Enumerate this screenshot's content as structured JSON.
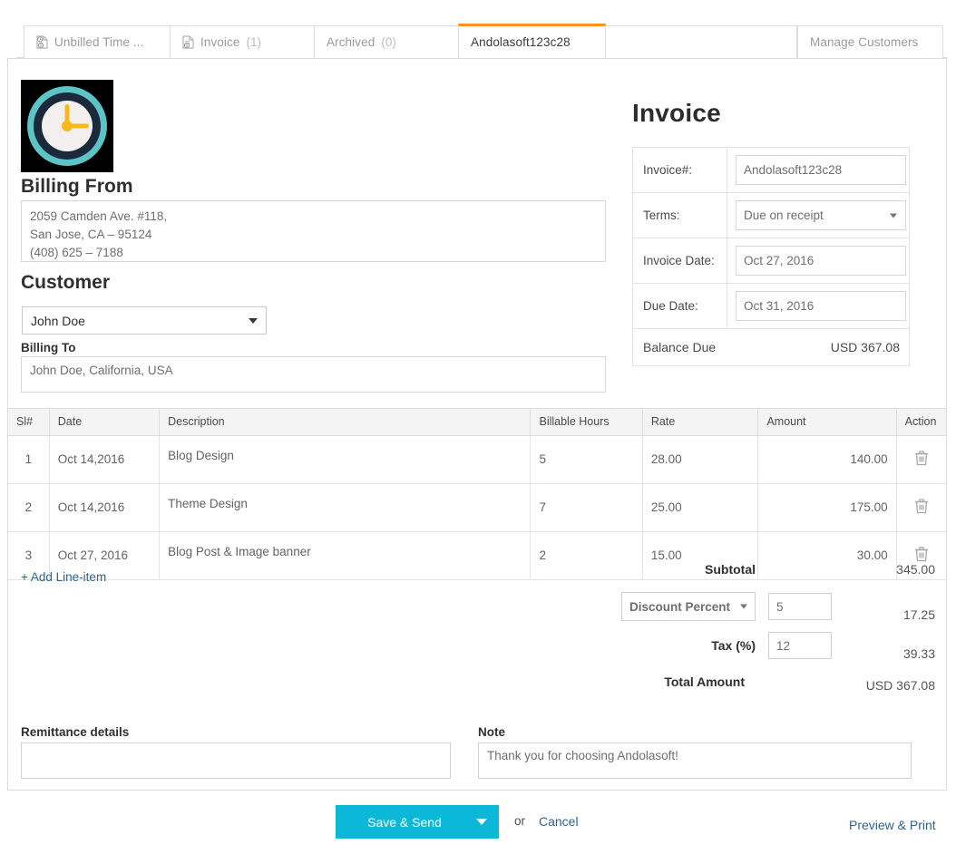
{
  "tabs": [
    {
      "id": "unbilled",
      "label": "Unbilled Time ...",
      "count": "",
      "icon": "document-clock-icon",
      "active": false
    },
    {
      "id": "invoice",
      "label": "Invoice",
      "count": "(1)",
      "icon": "document-dollar-icon",
      "active": false
    },
    {
      "id": "archived",
      "label": "Archived",
      "count": "(0)",
      "icon": "",
      "active": false
    },
    {
      "id": "current",
      "label": "Andolasoft123c28",
      "count": "",
      "icon": "",
      "active": true
    },
    {
      "id": "manage",
      "label": "Manage Customers",
      "count": "",
      "icon": "",
      "active": false
    }
  ],
  "logo": {
    "name": "clock-logo",
    "ring_outer": "#5cc3c6",
    "ring_inner": "#1b2a3a",
    "face": "#f2f0ef",
    "hands": "#f5b91c",
    "background": "#000000"
  },
  "billing_from": {
    "heading": "Billing From",
    "value": "2059 Camden Ave. #118,\nSan Jose, CA – 95124\n(408) 625 – 7188"
  },
  "customer": {
    "heading": "Customer",
    "selected": "John Doe",
    "billing_to_label": "Billing To",
    "billing_to_value": "John Doe, California, USA"
  },
  "invoice": {
    "title": "Invoice",
    "number_label": "Invoice#:",
    "number_value": "Andolasoft123c28",
    "terms_label": "Terms:",
    "terms_value": "Due on receipt",
    "invoice_date_label": "Invoice Date:",
    "invoice_date_value": "Oct 27, 2016",
    "due_date_label": "Due Date:",
    "due_date_value": "Oct 31, 2016",
    "balance_due_label": "Balance Due",
    "balance_due_value": "USD 367.08"
  },
  "table": {
    "headers": [
      "Sl#",
      "Date",
      "Description",
      "Billable Hours",
      "Rate",
      "Amount",
      "Action"
    ],
    "rows": [
      {
        "sl": "1",
        "date": "Oct 14,2016",
        "description": "Blog Design",
        "hours": "5",
        "rate": "28.00",
        "amount": "140.00",
        "action_icon": "trash-icon"
      },
      {
        "sl": "2",
        "date": "Oct 14,2016",
        "description": "Theme Design",
        "hours": "7",
        "rate": "25.00",
        "amount": "175.00",
        "action_icon": "trash-icon"
      },
      {
        "sl": "3",
        "date": "Oct 27, 2016",
        "description": "Blog Post & Image banner",
        "hours": "2",
        "rate": "15.00",
        "amount": "30.00",
        "action_icon": "trash-icon"
      }
    ],
    "add_line_label": "+ Add Line-item"
  },
  "totals": {
    "subtotal_label": "Subtotal",
    "subtotal_value": "345.00",
    "discount_type": "Discount Percent",
    "discount_input": "5",
    "discount_value": "17.25",
    "tax_label": "Tax (%)",
    "tax_input": "12",
    "tax_value": "39.33",
    "total_label": "Total Amount",
    "total_value": "USD 367.08"
  },
  "footer": {
    "remittance_label": "Remittance details",
    "remittance_value": "",
    "note_label": "Note",
    "note_value": "Thank you for choosing Andolasoft!"
  },
  "actions": {
    "save_label": "Save & Send",
    "or_label": "or",
    "cancel_label": "Cancel",
    "preview_label": "Preview & Print",
    "accent_color": "#0cb8d8",
    "link_color": "#2f6389",
    "active_tab_color": "#f79324"
  }
}
